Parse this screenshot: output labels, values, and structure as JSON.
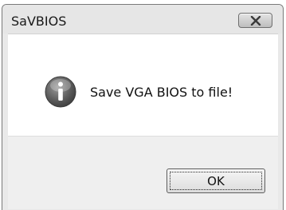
{
  "window": {
    "title": "SaVBIOS"
  },
  "titlebar": {
    "close_icon": "close-icon"
  },
  "message": {
    "icon": "info-icon",
    "text": "Save VGA BIOS to file!"
  },
  "buttons": {
    "ok_label": "OK"
  },
  "colors": {
    "frame": "#e6e6e6",
    "client": "#ffffff",
    "button_strip": "#efefef",
    "icon_fill": "#5a5a5a"
  }
}
